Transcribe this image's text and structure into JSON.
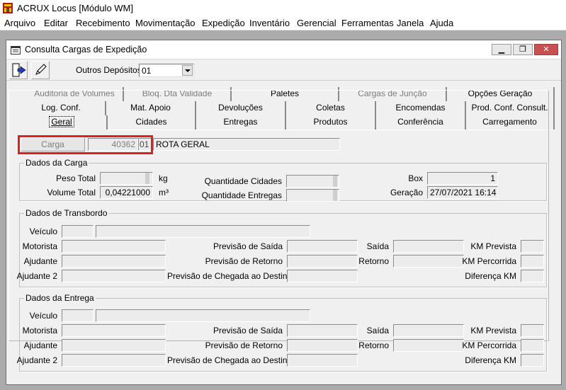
{
  "app": {
    "title": "ACRUX Locus [Módulo WM]"
  },
  "menu": [
    "Arquivo",
    "Editar",
    "Recebimento",
    "Movimentação",
    "Expedição",
    "Inventário",
    "Gerencial",
    "Ferramentas",
    "Janela",
    "Ajuda"
  ],
  "window": {
    "title": "Consulta Cargas de Expedição"
  },
  "toolbar": {
    "outros_label": "Outros Depósitos",
    "outros_value": "01"
  },
  "tabs": {
    "row1": [
      "Auditoria de Volumes",
      "Bloq. Dta Validade",
      "Paletes",
      "Cargas de Junção",
      "Opções Geração"
    ],
    "row2": [
      "Log. Conf.",
      "Mat. Apoio",
      "Devoluções",
      "Coletas",
      "Encomendas",
      "Prod. Conf. Consult."
    ],
    "row3": [
      "Geral",
      "Cidades",
      "Entregas",
      "Produtos",
      "Conferência",
      "Carregamento"
    ]
  },
  "carga": {
    "button_label": "Carga",
    "number": "40362",
    "code": "01",
    "route": "ROTA GERAL"
  },
  "dados_carga": {
    "title": "Dados da Carga",
    "peso_label": "Peso Total",
    "peso_value": "",
    "peso_unit": "kg",
    "volume_label": "Volume Total",
    "volume_value": "0,04221000",
    "volume_unit": "m³",
    "qtd_cidades_label": "Quantidade Cidades",
    "qtd_cidades_value": "",
    "qtd_entregas_label": "Quantidade Entregas",
    "qtd_entregas_value": "",
    "box_label": "Box",
    "box_value": "1",
    "geracao_label": "Geração",
    "geracao_value": "27/07/2021 16:14"
  },
  "transbordo": {
    "title": "Dados de Transbordo",
    "veiculo": "Veículo",
    "motorista": "Motorista",
    "ajudante": "Ajudante",
    "ajudante2": "Ajudante 2",
    "prev_saida": "Previsão de Saída",
    "prev_retorno": "Previsão de Retorno",
    "prev_chegada": "Previsão de Chegada ao Destino",
    "saida": "Saída",
    "retorno": "Retorno",
    "km_prevista": "KM Prevista",
    "km_percorrida": "KM Percorrida",
    "diferenca_km": "Diferença KM"
  },
  "entrega": {
    "title": "Dados da Entrega",
    "veiculo": "Veículo",
    "motorista": "Motorista",
    "ajudante": "Ajudante",
    "ajudante2": "Ajudante 2",
    "prev_saida": "Previsão de Saída",
    "prev_retorno": "Previsão de Retorno",
    "prev_chegada": "Previsão de Chegada ao Destino",
    "saida": "Saída",
    "retorno": "Retorno",
    "km_prevista": "KM Prevista",
    "km_percorrida": "KM Percorrida",
    "diferenca_km": "Diferença KM"
  }
}
